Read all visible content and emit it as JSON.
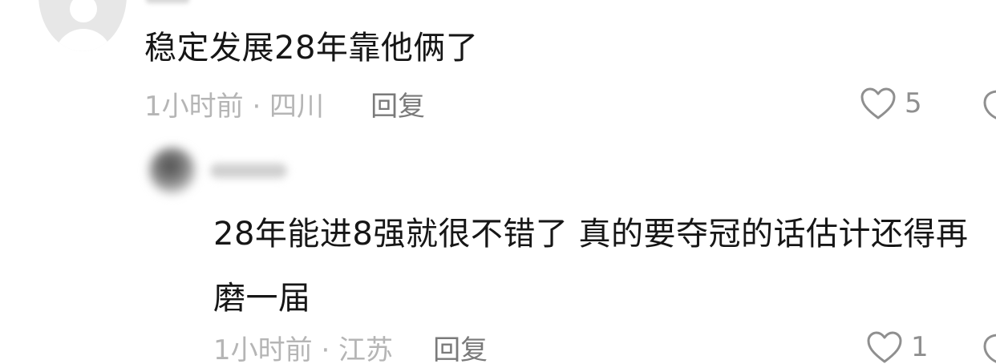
{
  "comment1": {
    "text": "稳定发展28年靠他俩了",
    "time_location": "1小时前 · 四川",
    "reply_label": "回复",
    "likes": "5",
    "like_icon": "heart-outline-icon"
  },
  "comment2": {
    "text": "28年能进8强就很不错了 真的要夺冠的话估计还得再磨一届",
    "time_location": "1小时前 · 江苏",
    "reply_label": "回复",
    "likes": "1",
    "like_icon": "heart-outline-icon"
  },
  "colors": {
    "text": "#161616",
    "meta": "#b5b5b5",
    "reply": "#7a7a7a",
    "icon": "#8f8f8f"
  }
}
